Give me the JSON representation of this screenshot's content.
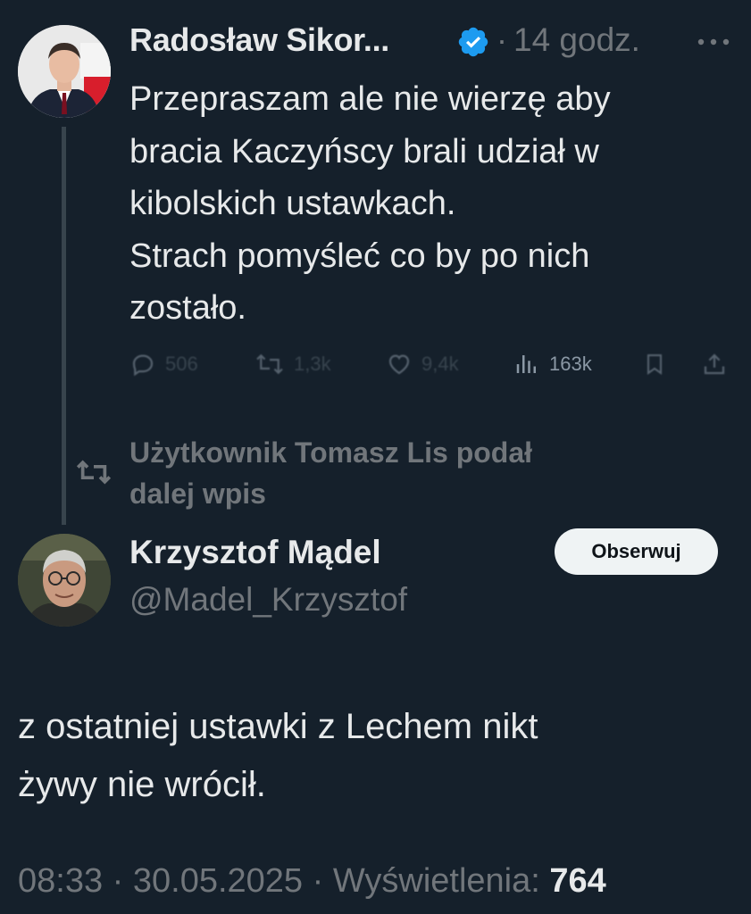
{
  "tweet1": {
    "author_name": "Radosław Sikor...",
    "time_separator": "·",
    "time": "14 godz.",
    "text_lines": [
      "Przepraszam ale nie wierzę aby",
      "bracia Kaczyńscy brali udział w",
      "kibolskich ustawkach.",
      "Strach pomyśleć co by po nich",
      "zostało."
    ],
    "stats": {
      "replies": "506",
      "reposts": "1,3k",
      "likes": "9,4k",
      "views": "163k"
    },
    "icons": {
      "verified": "verified-badge-icon",
      "more": "more-dots-icon",
      "reply": "reply-bubble-icon",
      "repost": "repost-icon",
      "like": "heart-icon",
      "views": "views-bars-icon",
      "bookmark": "bookmark-icon",
      "share": "share-icon"
    },
    "colors": {
      "verified": "#1d9bf0"
    }
  },
  "repost_notice": {
    "lines": [
      "Użytkownik Tomasz Lis podał",
      "dalej wpis"
    ]
  },
  "tweet2": {
    "author_name": "Krzysztof Mądel",
    "handle": "@Madel_Krzysztof",
    "follow_label": "Obserwuj",
    "text_lines": [
      "z ostatniej ustawki z Lechem nikt",
      "żywy nie wrócił."
    ],
    "meta_time": "08:33",
    "meta_sep1": "·",
    "meta_date": "30.05.2025",
    "meta_sep2": "·",
    "meta_views_label": "Wyświetlenia:",
    "meta_views_value": "764"
  },
  "colors": {
    "background": "#15202b",
    "text": "#e7e9ea",
    "muted": "#71767b",
    "thread_line": "#38444d"
  }
}
